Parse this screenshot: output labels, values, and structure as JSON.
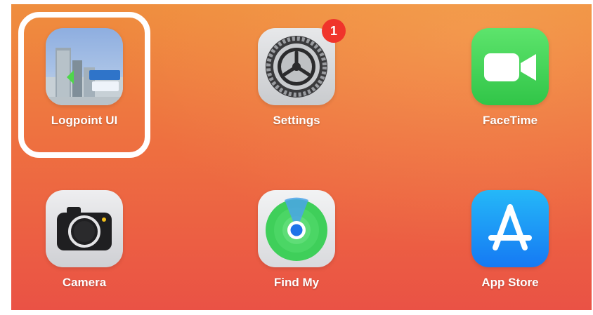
{
  "apps": [
    {
      "id": "logpoint",
      "label": "Logpoint UI",
      "icon": "city-skyline-icon",
      "selected": true
    },
    {
      "id": "settings",
      "label": "Settings",
      "icon": "gear-icon",
      "badge": "1"
    },
    {
      "id": "facetime",
      "label": "FaceTime",
      "icon": "video-camera-icon"
    },
    {
      "id": "camera",
      "label": "Camera",
      "icon": "camera-icon"
    },
    {
      "id": "findmy",
      "label": "Find My",
      "icon": "radar-icon"
    },
    {
      "id": "appstore",
      "label": "App Store",
      "icon": "app-store-a-icon"
    }
  ],
  "colors": {
    "wallpaper_top": "#ef8e3e",
    "wallpaper_bottom": "#ea5245",
    "badge": "#f0342b",
    "facetime_green": "#31c548",
    "findmy_green": "#3fcf5a",
    "appstore_blue": "#1579f3"
  }
}
